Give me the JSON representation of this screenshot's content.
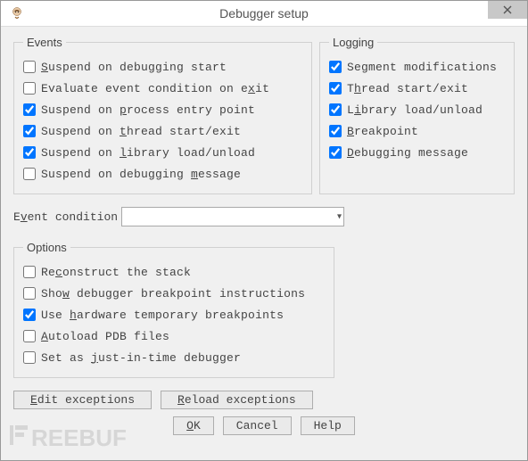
{
  "window": {
    "title": "Debugger setup"
  },
  "events": {
    "legend": "Events",
    "items": [
      {
        "label_pre": "",
        "u": "S",
        "label_post": "uspend on debugging start",
        "checked": false
      },
      {
        "label_pre": "Evaluate event condition on e",
        "u": "x",
        "label_post": "it",
        "checked": false
      },
      {
        "label_pre": "Suspend on ",
        "u": "p",
        "label_post": "rocess entry point",
        "checked": true
      },
      {
        "label_pre": "Suspend on ",
        "u": "t",
        "label_post": "hread start/exit",
        "checked": true
      },
      {
        "label_pre": "Suspend on ",
        "u": "l",
        "label_post": "ibrary load/unload",
        "checked": true
      },
      {
        "label_pre": "Suspend on debugging ",
        "u": "m",
        "label_post": "essage",
        "checked": false
      }
    ]
  },
  "logging": {
    "legend": "Logging",
    "items": [
      {
        "label_pre": "Se",
        "u": "g",
        "label_post": "ment modifications",
        "checked": true
      },
      {
        "label_pre": "T",
        "u": "h",
        "label_post": "read start/exit",
        "checked": true
      },
      {
        "label_pre": "L",
        "u": "i",
        "label_post": "brary load/unload",
        "checked": true
      },
      {
        "label_pre": "",
        "u": "B",
        "label_post": "reakpoint",
        "checked": true
      },
      {
        "label_pre": "",
        "u": "D",
        "label_post": "ebugging message",
        "checked": true
      }
    ]
  },
  "event_condition": {
    "label_pre": "E",
    "u": "v",
    "label_post": "ent condition",
    "value": ""
  },
  "options": {
    "legend": "Options",
    "items": [
      {
        "label_pre": "Re",
        "u": "c",
        "label_post": "onstruct the stack",
        "checked": false
      },
      {
        "label_pre": "Sho",
        "u": "w",
        "label_post": " debugger breakpoint instructions",
        "checked": false
      },
      {
        "label_pre": "Use ",
        "u": "h",
        "label_post": "ardware temporary breakpoints",
        "checked": true
      },
      {
        "label_pre": "",
        "u": "A",
        "label_post": "utoload PDB files",
        "checked": false
      },
      {
        "label_pre": "Set as ",
        "u": "j",
        "label_post": "ust-in-time debugger",
        "checked": false
      }
    ]
  },
  "buttons": {
    "edit_exceptions": {
      "pre": "",
      "u": "E",
      "post": "dit exceptions"
    },
    "reload_exceptions": {
      "pre": "",
      "u": "R",
      "post": "eload exceptions"
    },
    "ok": {
      "pre": "",
      "u": "O",
      "post": "K"
    },
    "cancel": "Cancel",
    "help": "Help"
  },
  "watermark": "REEBUF"
}
